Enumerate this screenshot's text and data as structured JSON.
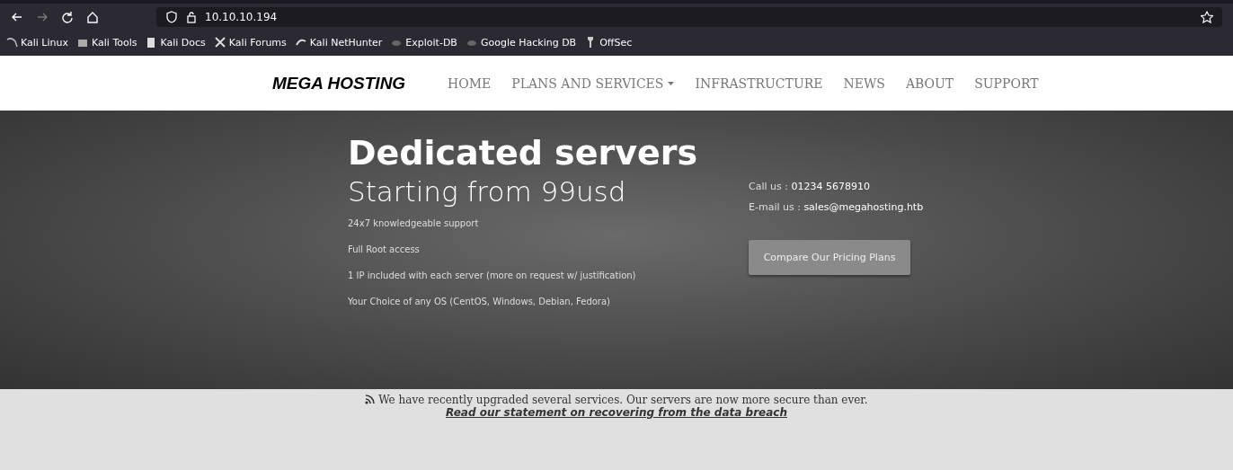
{
  "browser": {
    "url": "10.10.10.194",
    "bookmarks": [
      {
        "label": "Kali Linux",
        "kind": "kali"
      },
      {
        "label": "Kali Tools",
        "kind": "tools"
      },
      {
        "label": "Kali Docs",
        "kind": "docs"
      },
      {
        "label": "Kali Forums",
        "kind": "forums"
      },
      {
        "label": "Kali NetHunter",
        "kind": "nethunter"
      },
      {
        "label": "Exploit-DB",
        "kind": "db"
      },
      {
        "label": "Google Hacking DB",
        "kind": "db"
      },
      {
        "label": "OffSec",
        "kind": "offsec"
      }
    ]
  },
  "navbar": {
    "brand": "MEGA HOSTING",
    "items": [
      {
        "label": "HOME",
        "dropdown": false
      },
      {
        "label": "PLANS AND SERVICES",
        "dropdown": true
      },
      {
        "label": "INFRASTRUCTURE",
        "dropdown": false
      },
      {
        "label": "NEWS",
        "dropdown": false
      },
      {
        "label": "ABOUT",
        "dropdown": false
      },
      {
        "label": "SUPPORT",
        "dropdown": false
      }
    ]
  },
  "hero": {
    "title": "Dedicated servers",
    "subtitle": "Starting from 99usd",
    "features": [
      "24x7 knowledgeable support",
      "Full Root access",
      "1 IP included with each server (more on request w/ justification)",
      "Your Choice of any OS (CentOS, Windows, Debian, Fedora)"
    ],
    "contacts": [
      {
        "label": "Call us : ",
        "value": "01234 5678910"
      },
      {
        "label": "E-mail us : ",
        "value": "sales@megahosting.htb"
      }
    ],
    "button": "Compare Our Pricing Plans"
  },
  "notice": {
    "text": "We have recently upgraded several services. Our servers are now more secure than ever. ",
    "link": "Read our statement on recovering from the data breach"
  }
}
